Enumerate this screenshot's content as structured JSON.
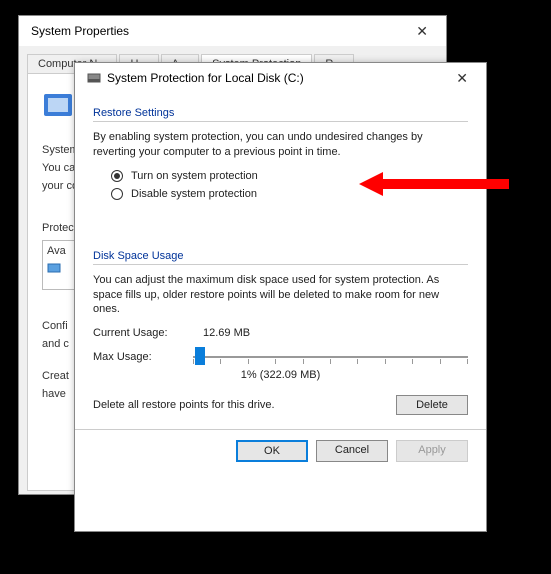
{
  "parent": {
    "title": "System Properties",
    "tabs": [
      "Computer N...",
      "H...",
      "A...",
      "System Protection",
      "R..."
    ],
    "section_label": "System",
    "desc1": "You ca",
    "desc2": "your co",
    "protect_label": "Protect",
    "list_header": "Ava",
    "configure_l1": "Confi",
    "configure_l2": "and c",
    "create_l1": "Creat",
    "create_l2": "have"
  },
  "child": {
    "title": "System Protection for Local Disk (C:)",
    "group1": "Restore Settings",
    "desc": "By enabling system protection, you can undo undesired changes by reverting your computer to a previous point in time.",
    "radio_on": "Turn on system protection",
    "radio_off": "Disable system protection",
    "group2": "Disk Space Usage",
    "desc2": "You can adjust the maximum disk space used for system protection. As space fills up, older restore points will be deleted to make room for new ones.",
    "current_usage_label": "Current Usage:",
    "current_usage_value": "12.69 MB",
    "max_usage_label": "Max Usage:",
    "slider_value": "1% (322.09 MB)",
    "delete_desc": "Delete all restore points for this drive.",
    "btn_delete": "Delete",
    "btn_ok": "OK",
    "btn_cancel": "Cancel",
    "btn_apply": "Apply"
  },
  "colors": {
    "accent": "#0a7edb",
    "link": "#003399",
    "arrow": "#ff0000"
  }
}
